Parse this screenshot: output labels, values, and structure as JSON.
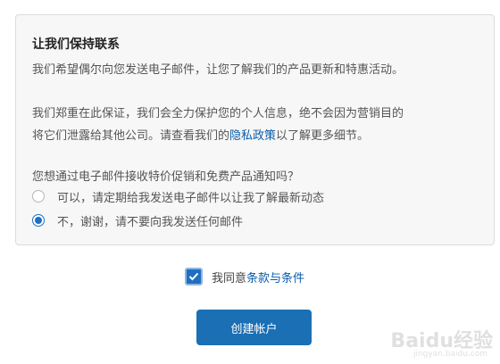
{
  "panel": {
    "title": "让我们保持联系",
    "paragraph1": "我们希望偶尔向您发送电子邮件，让您了解我们的产品更新和特惠活动。",
    "paragraph2_line1": "我们郑重在此保证，我们会全力保护您的个人信息，绝不会因为营销目的",
    "paragraph2_line2_before": "将它们泄露给其他公司。请查看我们的",
    "privacy_link": "隐私政策",
    "paragraph2_line2_after": "以了解更多细节。",
    "question": "您想通过电子邮件接收特价促销和免费产品通知吗？",
    "options": [
      {
        "label": "可以，请定期给我发送电子邮件以让我了解最新动态",
        "checked": false
      },
      {
        "label": "不，谢谢，请不要向我发送任何邮件",
        "checked": true
      }
    ]
  },
  "agreement": {
    "checked": true,
    "prefix": "我同意",
    "terms_link": "条款与条件"
  },
  "create_button": "创建帐户",
  "watermark": {
    "logo_text": "Baidu经验",
    "url": "jingyan.baidu.com"
  },
  "colors": {
    "accent": "#1f6fc0",
    "button": "#1a6fb5",
    "link": "#0a5ca8",
    "panel_bg": "#f7f7f7"
  }
}
